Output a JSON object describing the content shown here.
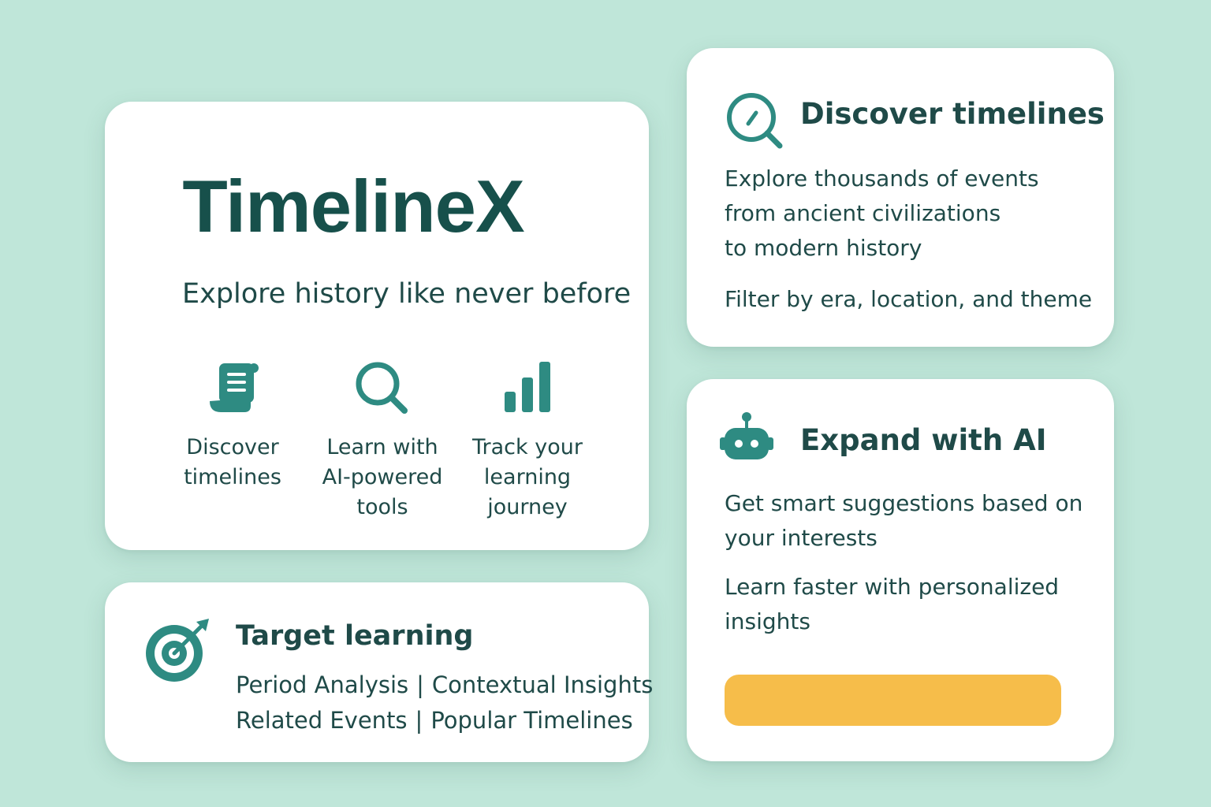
{
  "colors": {
    "background": "#bfe6d9",
    "card": "#ffffff",
    "accent": "#2e8b82",
    "text": "#1f4a48",
    "cta": "#f6bd4a"
  },
  "hero": {
    "brand": "TimelineX",
    "tagline": "Explore history like never before",
    "features": [
      {
        "icon": "scroll-icon",
        "label": "Discover\ntimelines"
      },
      {
        "icon": "search-icon",
        "label": "Learn with\nAI-powered\ntools"
      },
      {
        "icon": "bar-chart-icon",
        "label": "Track your\nlearning\njourney"
      }
    ]
  },
  "target": {
    "icon": "target-icon",
    "title": "Target learning",
    "tags": [
      "Period Analysis",
      "Contextual Insights",
      "Related Events",
      "Popular Timelines"
    ]
  },
  "discover": {
    "icon": "search-icon",
    "title": "Discover timelines",
    "description": "Explore thousands of events\nfrom ancient civilizations\nto modern history",
    "filter_text": "Filter by era, location, and theme"
  },
  "ai": {
    "icon": "robot-icon",
    "title": "Expand with AI",
    "description": "Get smart suggestions based on your interests",
    "insights": "Learn faster with personalized insights",
    "cta_label": ""
  }
}
